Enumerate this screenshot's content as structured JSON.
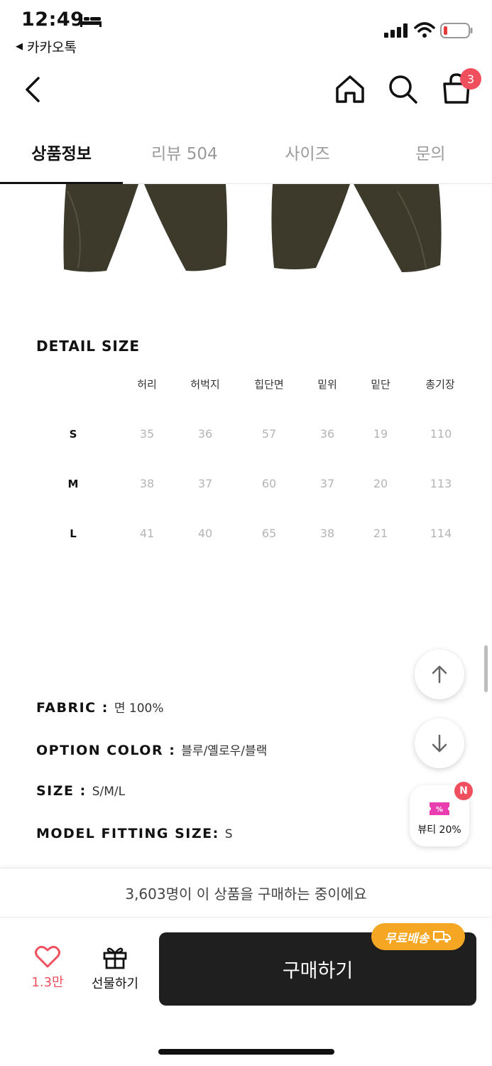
{
  "status_bar": {
    "time": "12:49",
    "back_app_label": "카카오톡"
  },
  "nav": {
    "cart_count": "3"
  },
  "tabs": [
    {
      "label": "상품정보",
      "active": true
    },
    {
      "label": "리뷰 504",
      "active": false
    },
    {
      "label": "사이즈",
      "active": false
    },
    {
      "label": "문의",
      "active": false
    }
  ],
  "detail_size": {
    "title": "DETAIL SIZE",
    "columns": [
      "허리",
      "허벅지",
      "힙단면",
      "밑위",
      "밑단",
      "총기장"
    ],
    "rows": [
      {
        "label": "S",
        "values": [
          "35",
          "36",
          "57",
          "36",
          "19",
          "110"
        ]
      },
      {
        "label": "M",
        "values": [
          "38",
          "37",
          "60",
          "37",
          "20",
          "113"
        ]
      },
      {
        "label": "L",
        "values": [
          "41",
          "40",
          "65",
          "38",
          "21",
          "114"
        ]
      }
    ]
  },
  "info": {
    "fabric_key": "FABRIC :",
    "fabric_val": "면 100%",
    "color_key": "OPTION COLOR :",
    "color_val": "블루/옐로우/블랙",
    "size_key": "SIZE :",
    "size_val": "S/M/L",
    "model_key": "MODEL FITTING SIZE:",
    "model_val": "S"
  },
  "floating": {
    "beauty_label": "뷰티 20%",
    "new_badge": "N"
  },
  "bottom": {
    "purchase_banner": "3,603명이 이 상품을 구매하는 중이에요",
    "like_count": "1.3만",
    "gift_label": "선물하기",
    "buy_label": "구매하기",
    "free_ship_label": "무료배송"
  },
  "colors": {
    "accent": "#f0505e",
    "buy_button": "#1f1f1f",
    "free_ship": "#f5a623",
    "pants": "#3d3a2c"
  }
}
